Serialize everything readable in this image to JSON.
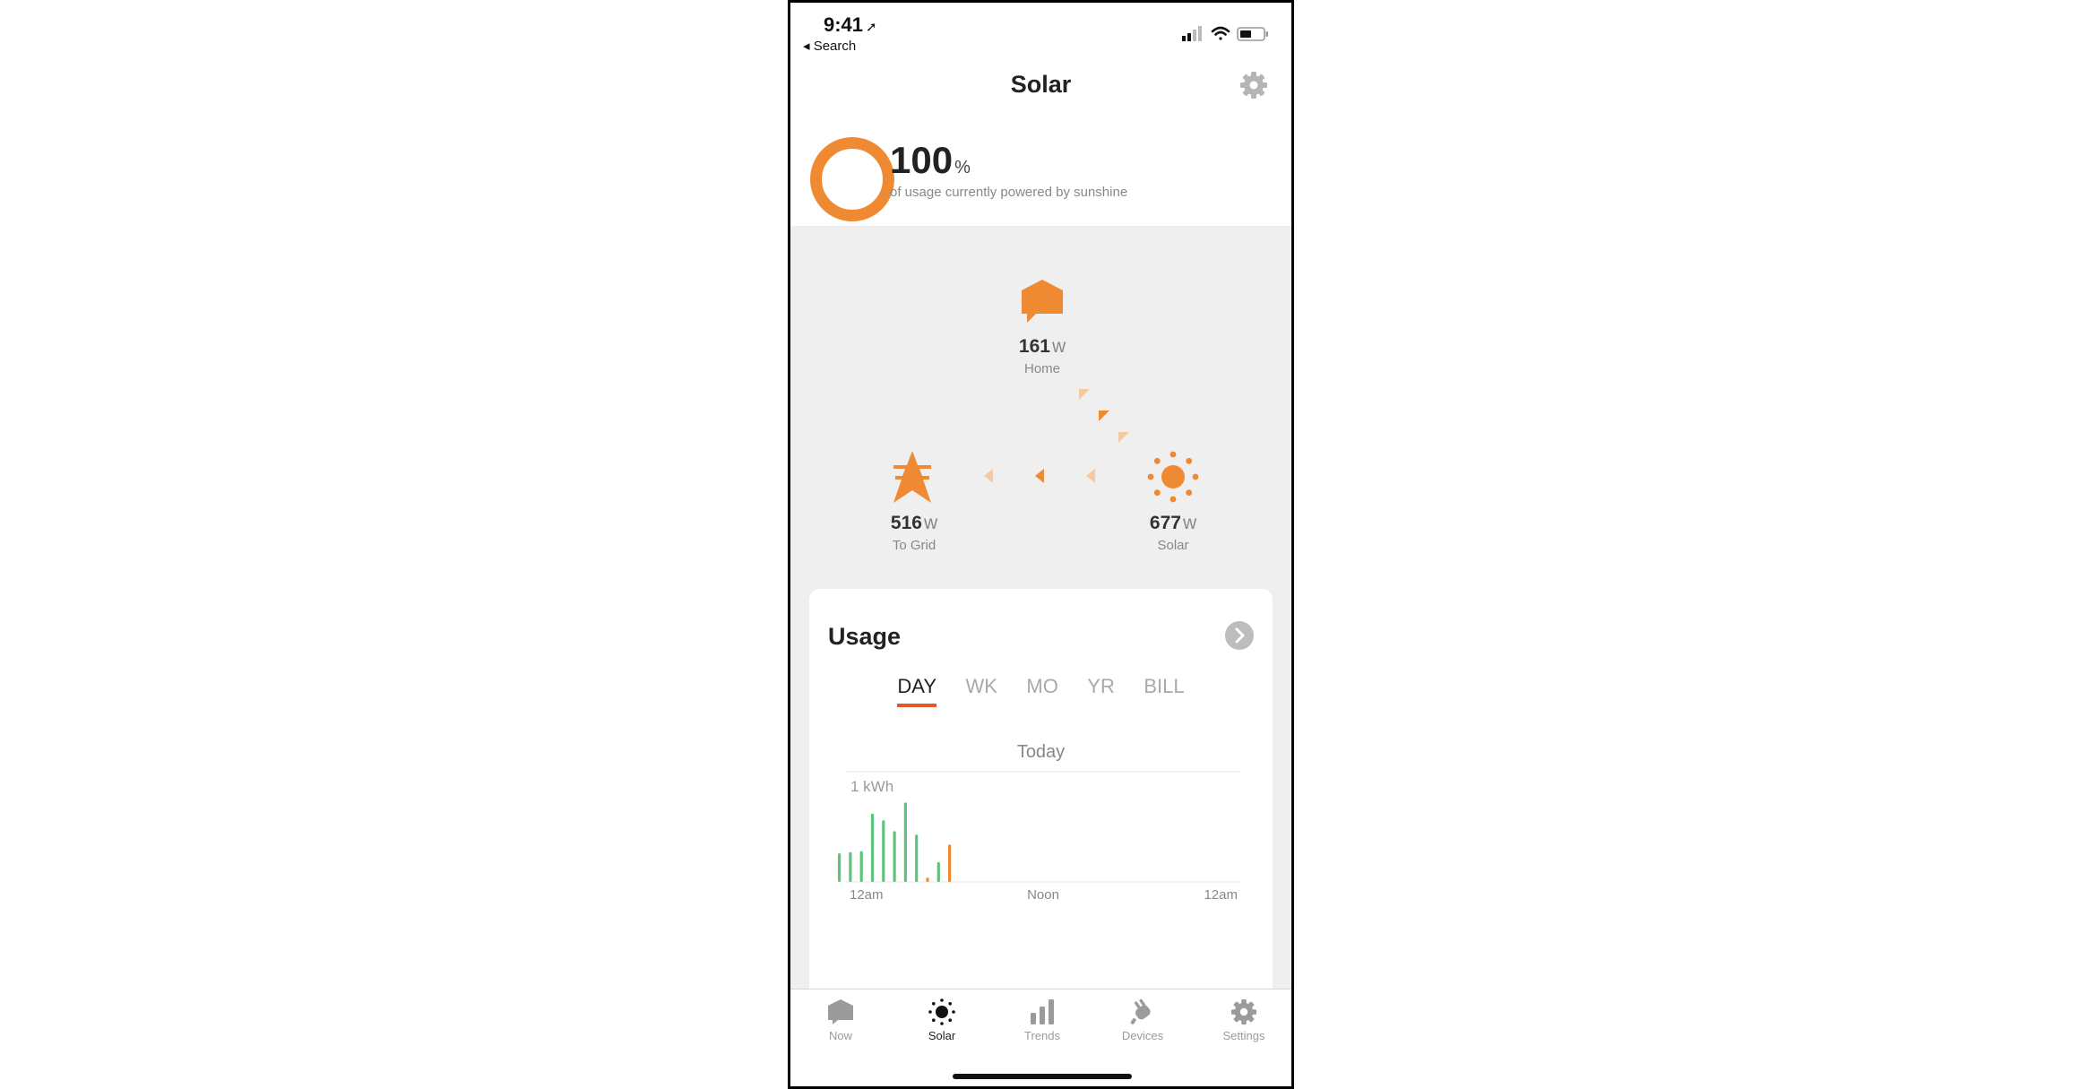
{
  "status": {
    "time": "9:41",
    "back_label": "◂ Search"
  },
  "nav": {
    "title": "Solar"
  },
  "hero": {
    "percent": "100",
    "percent_unit": "%",
    "subtitle": "of usage currently powered by sunshine"
  },
  "flow": {
    "home": {
      "value": "161",
      "unit": "w",
      "label": "Home"
    },
    "grid": {
      "value": "516",
      "unit": "w",
      "label": "To Grid"
    },
    "solar": {
      "value": "677",
      "unit": "w",
      "label": "Solar"
    }
  },
  "usage": {
    "title": "Usage",
    "tabs": [
      "DAY",
      "WK",
      "MO",
      "YR",
      "BILL"
    ],
    "active_tab": "DAY",
    "period_label": "Today"
  },
  "chart_data": {
    "type": "bar",
    "ylabel": "1 kWh",
    "x_tick_labels": [
      "12am",
      "Noon",
      "12am"
    ],
    "values": [
      0.26,
      0.27,
      0.28,
      0.62,
      0.56,
      0.46,
      0.72,
      0.43,
      0.04,
      0.18,
      0.34
    ],
    "colors": [
      "#5fc27e",
      "#5fc27e",
      "#5fc27e",
      "#5fc27e",
      "#5fc27e",
      "#5fc27e",
      "#5fc27e",
      "#5fc27e",
      "#ef8a33",
      "#5fc27e",
      "#ef8a33"
    ],
    "ylim": [
      0,
      1
    ],
    "grid": true
  },
  "tabbar": {
    "items": [
      {
        "label": "Now",
        "icon": "house-icon"
      },
      {
        "label": "Solar",
        "icon": "sun-icon"
      },
      {
        "label": "Trends",
        "icon": "bar-chart-icon"
      },
      {
        "label": "Devices",
        "icon": "plug-icon"
      },
      {
        "label": "Settings",
        "icon": "gear-icon"
      }
    ],
    "active": "Solar"
  },
  "colors": {
    "accent": "#ef8a33",
    "green": "#5fc27e",
    "tab_underline": "#e2572b",
    "flow_bg": "#efefef"
  }
}
